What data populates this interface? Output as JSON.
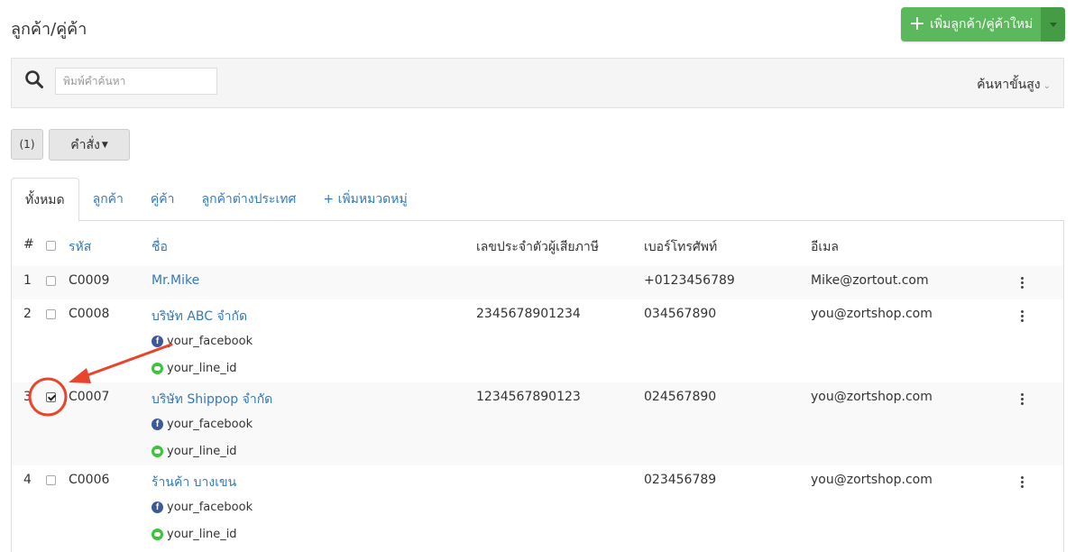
{
  "header": {
    "title": "ลูกค้า/คู่ค้า",
    "add_button_label": "เพิ่มลูกค้า/คู่ค้าใหม่",
    "add_button_color": "#5cb85c"
  },
  "search": {
    "placeholder": "พิมพ์คำค้นหา",
    "advanced_label": "ค้นหาขั้นสูง"
  },
  "actions": {
    "selected_count": "(1)",
    "command_label": "คำสั่ง"
  },
  "tabs": [
    {
      "label": "ทั้งหมด",
      "active": true
    },
    {
      "label": "ลูกค้า"
    },
    {
      "label": "คู่ค้า"
    },
    {
      "label": "ลูกค้าต่างประเทศ"
    },
    {
      "label": "+ เพิ่มหมวดหมู่"
    }
  ],
  "table": {
    "columns": {
      "index": "#",
      "code": "รหัส",
      "name": "ชื่อ",
      "tax_id": "เลขประจำตัวผู้เสียภาษี",
      "phone": "เบอร์โทรศัพท์",
      "email": "อีเมล"
    },
    "rows": [
      {
        "index": "1",
        "code": "C0009",
        "name": "Mr.Mike",
        "tax_id": "",
        "phone": "+0123456789",
        "email": "Mike@zortout.com",
        "checked": false,
        "facebook": "",
        "line": ""
      },
      {
        "index": "2",
        "code": "C0008",
        "name": "บริษัท ABC จำกัด",
        "tax_id": "2345678901234",
        "phone": "034567890",
        "email": "you@zortshop.com",
        "checked": false,
        "facebook": "your_facebook",
        "line": "your_line_id"
      },
      {
        "index": "3",
        "code": "C0007",
        "name": "บริษัท Shippop จำกัด",
        "tax_id": "1234567890123",
        "phone": "024567890",
        "email": "you@zortshop.com",
        "checked": true,
        "facebook": "your_facebook",
        "line": "your_line_id"
      },
      {
        "index": "4",
        "code": "C0006",
        "name": "ร้านค้า บางเขน",
        "tax_id": "",
        "phone": "023456789",
        "email": "you@zortshop.com",
        "checked": false,
        "facebook": "your_facebook",
        "line": "your_line_id"
      }
    ]
  },
  "annotation_color": "#e8452c",
  "icons": {
    "search": "search-icon",
    "plus": "plus-icon",
    "facebook": "facebook-icon",
    "line": "line-icon",
    "more": "more-vertical-icon"
  }
}
